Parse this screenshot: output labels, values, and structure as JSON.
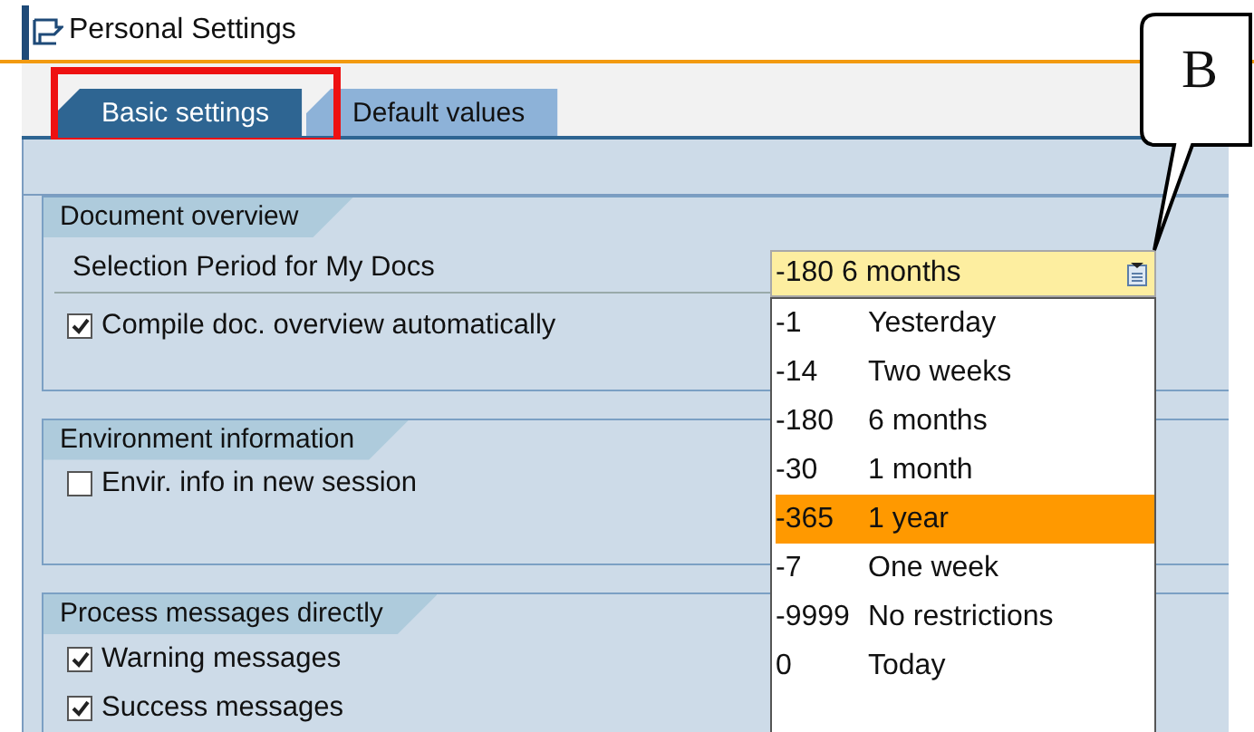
{
  "window": {
    "title": "Personal Settings"
  },
  "tabs": [
    {
      "label": "Basic settings",
      "selected": true,
      "highlighted": true
    },
    {
      "label": "Default values",
      "selected": false,
      "highlighted": false
    }
  ],
  "groups": [
    {
      "title": "Document overview",
      "rows": [
        {
          "kind": "label",
          "label": "Selection Period for My Docs"
        },
        {
          "kind": "checkbox",
          "label": "Compile doc. overview automatically",
          "checked": true
        }
      ]
    },
    {
      "title": "Environment information",
      "rows": [
        {
          "kind": "checkbox",
          "label": "Envir. info in new session",
          "checked": false
        }
      ]
    },
    {
      "title": "Process messages directly",
      "rows": [
        {
          "kind": "checkbox",
          "label": "Warning messages",
          "checked": true
        },
        {
          "kind": "checkbox",
          "label": "Success messages",
          "checked": true
        }
      ]
    }
  ],
  "dropdown": {
    "value": "-180 6 months",
    "options": [
      {
        "code": "-1",
        "text": "Yesterday",
        "selected": false
      },
      {
        "code": "-14",
        "text": "Two weeks",
        "selected": false
      },
      {
        "code": "-180",
        "text": "6 months",
        "selected": false
      },
      {
        "code": "-30",
        "text": "1 month",
        "selected": false
      },
      {
        "code": "-365",
        "text": "1 year",
        "selected": true
      },
      {
        "code": "-7",
        "text": "One week",
        "selected": false
      },
      {
        "code": "-9999",
        "text": "No restrictions",
        "selected": false
      },
      {
        "code": "0",
        "text": "Today",
        "selected": false
      }
    ]
  },
  "callout": {
    "label": "B"
  }
}
